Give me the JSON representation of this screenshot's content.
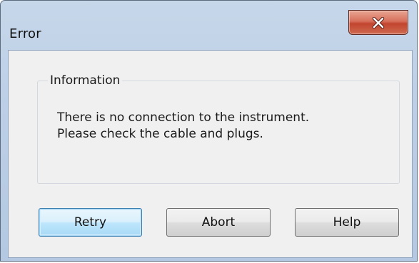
{
  "window": {
    "title": "Error"
  },
  "titlebar": {
    "close_icon": "close-x-icon"
  },
  "group": {
    "legend": "Information",
    "message_line1": "There is no connection to the instrument.",
    "message_line2": "Please check the cable and plugs."
  },
  "buttons": {
    "retry": "Retry",
    "abort": "Abort",
    "help": "Help"
  },
  "colors": {
    "close_button": "#c94a36",
    "default_button_border": "#3c7fb1",
    "frame": "#b9cde5"
  }
}
